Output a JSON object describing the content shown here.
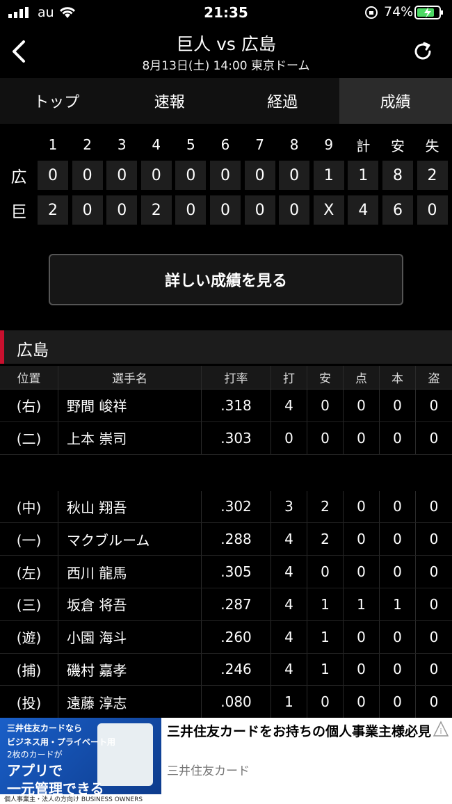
{
  "status": {
    "carrier": "au",
    "time": "21:35",
    "battery": "74%"
  },
  "header": {
    "title": "巨人 vs 広島",
    "subtitle": "8月13日(土) 14:00 東京ドーム"
  },
  "tabs": [
    {
      "label": "トップ",
      "active": false
    },
    {
      "label": "速報",
      "active": false
    },
    {
      "label": "経過",
      "active": false
    },
    {
      "label": "成績",
      "active": true
    }
  ],
  "scoreboard": {
    "headers": [
      "1",
      "2",
      "3",
      "4",
      "5",
      "6",
      "7",
      "8",
      "9",
      "計",
      "安",
      "失"
    ],
    "rows": [
      {
        "team": "広",
        "cells": [
          "0",
          "0",
          "0",
          "0",
          "0",
          "0",
          "0",
          "0",
          "1",
          "1",
          "8",
          "2"
        ]
      },
      {
        "team": "巨",
        "cells": [
          "2",
          "0",
          "0",
          "2",
          "0",
          "0",
          "0",
          "0",
          "X",
          "4",
          "6",
          "0"
        ]
      }
    ]
  },
  "detail_button": "詳しい成績を見る",
  "team_section": {
    "name": "広島",
    "accent": "#c8102e"
  },
  "batting": {
    "headers": [
      "位置",
      "選手名",
      "打率",
      "打",
      "安",
      "点",
      "本",
      "盗"
    ],
    "rows": [
      [
        "(右)",
        "野間 峻祥",
        ".318",
        "4",
        "0",
        "0",
        "0",
        "0"
      ],
      [
        "(二)",
        "上本 崇司",
        ".303",
        "0",
        "0",
        "0",
        "0",
        "0"
      ],
      [
        "(中)",
        "秋山 翔吾",
        ".302",
        "3",
        "2",
        "0",
        "0",
        "0"
      ],
      [
        "(一)",
        "マクブルーム",
        ".288",
        "4",
        "2",
        "0",
        "0",
        "0"
      ],
      [
        "(左)",
        "西川 龍馬",
        ".305",
        "4",
        "0",
        "0",
        "0",
        "0"
      ],
      [
        "(三)",
        "坂倉 将吾",
        ".287",
        "4",
        "1",
        "1",
        "1",
        "0"
      ],
      [
        "(遊)",
        "小園 海斗",
        ".260",
        "4",
        "1",
        "0",
        "0",
        "0"
      ],
      [
        "(捕)",
        "磯村 嘉孝",
        ".246",
        "4",
        "1",
        "0",
        "0",
        "0"
      ],
      [
        "(投)",
        "遠藤 淳志",
        ".080",
        "1",
        "0",
        "0",
        "0",
        "0"
      ]
    ]
  },
  "ad": {
    "img_lines": [
      "三井住友カードなら",
      "ビジネス用・プライベート用",
      "2枚のカードが",
      "アプリで",
      "一元管理できる",
      "個人事業主・法人の方向け  BUSINESS OWNERS"
    ],
    "headline": "三井住友カードをお持ちの個人事業主様必見",
    "brand": "三井住友カード"
  }
}
